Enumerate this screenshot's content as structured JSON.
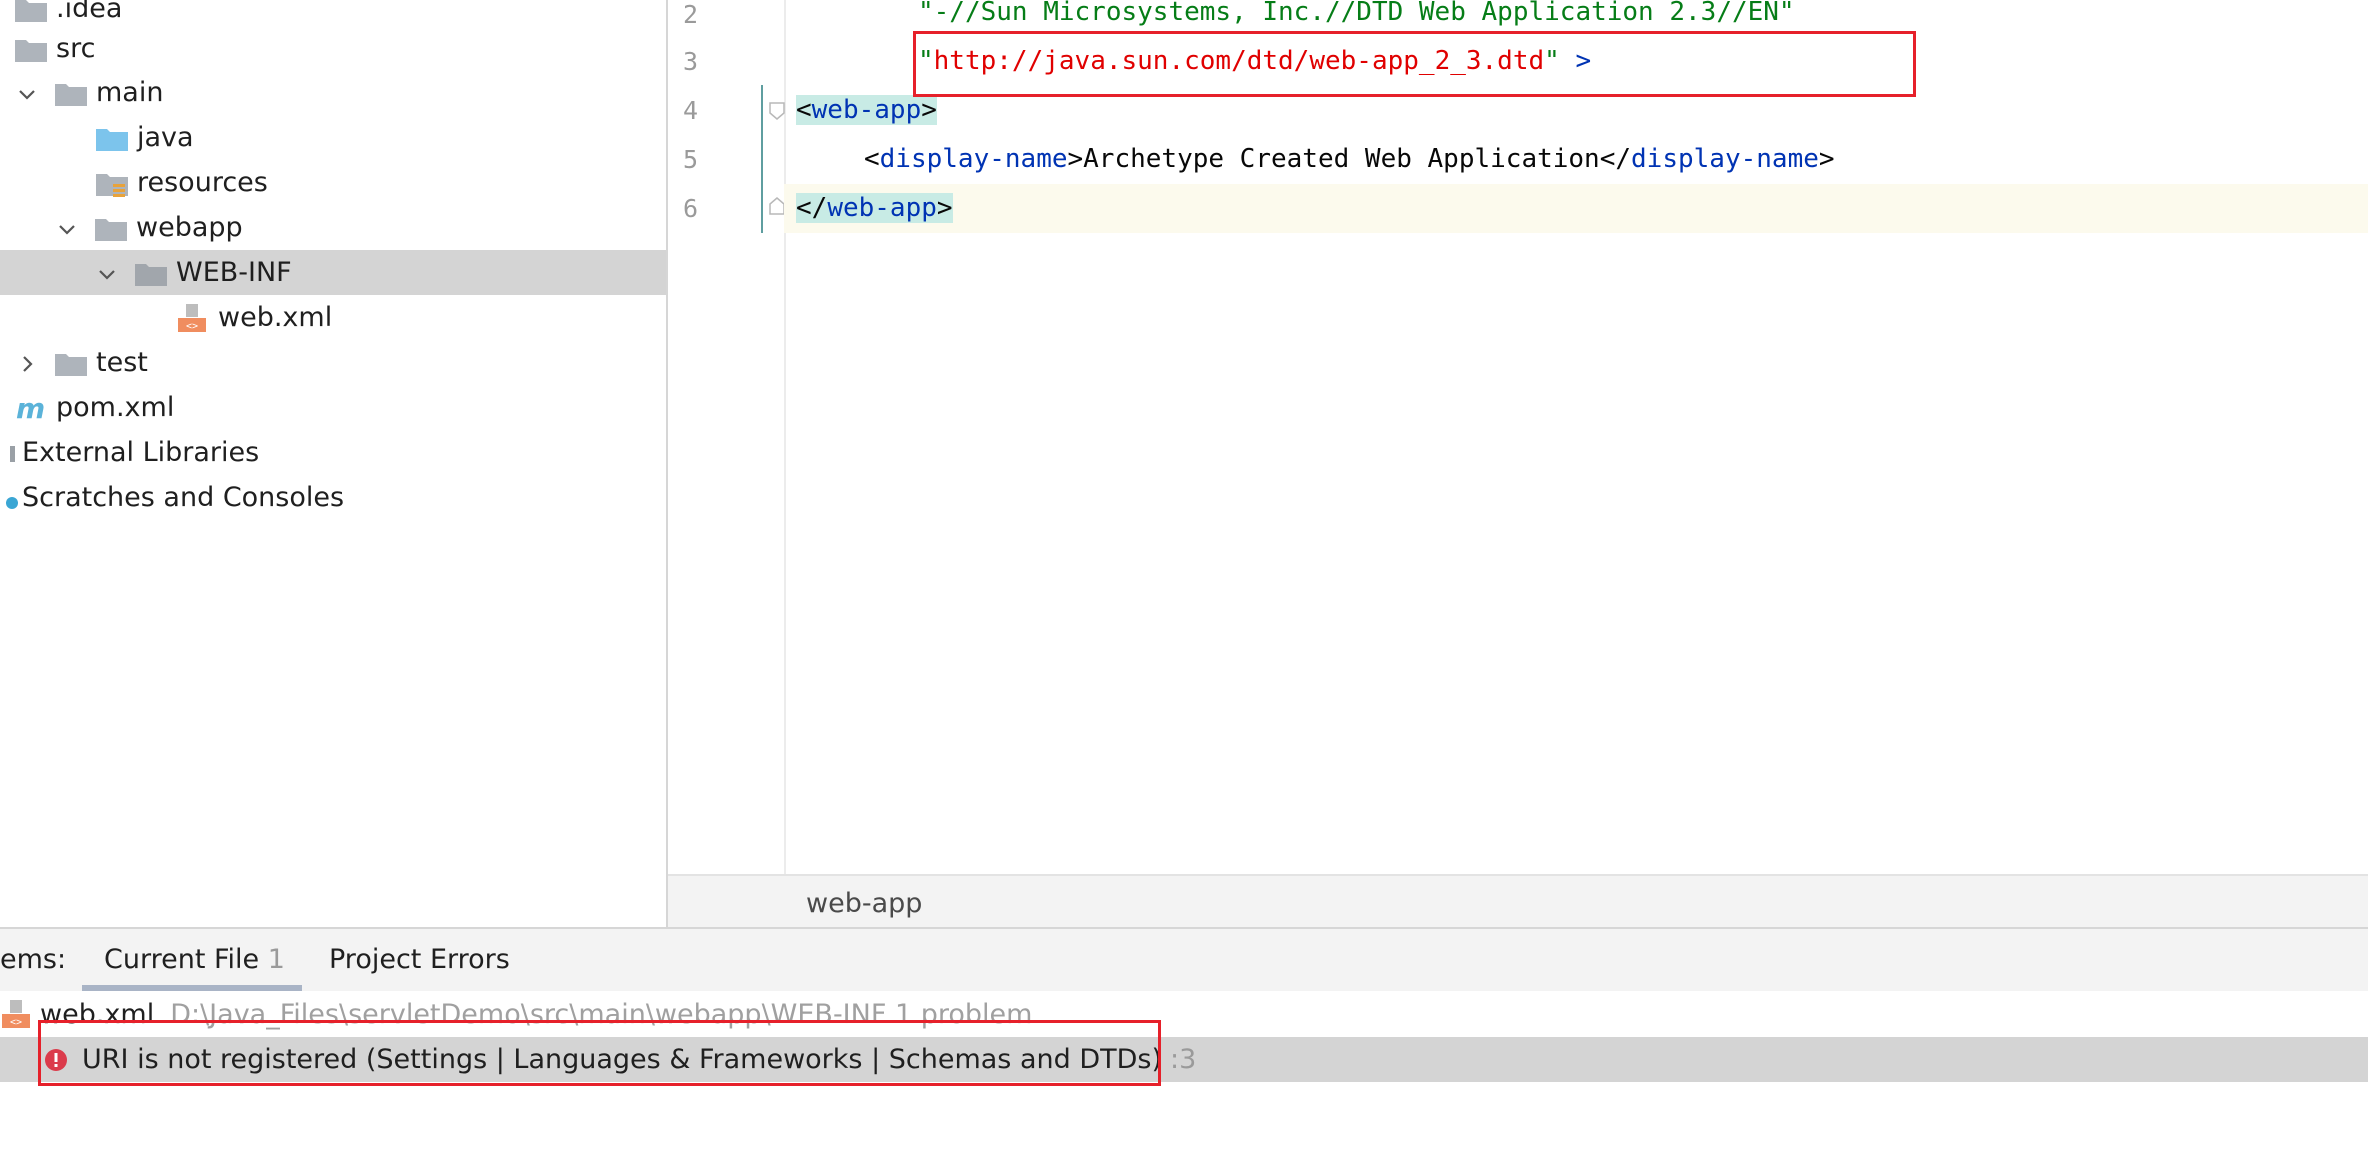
{
  "project_tree": {
    "items": [
      {
        "label": ".idea"
      },
      {
        "label": "src"
      },
      {
        "label": "main"
      },
      {
        "label": "java"
      },
      {
        "label": "resources"
      },
      {
        "label": "webapp"
      },
      {
        "label": "WEB-INF"
      },
      {
        "label": "web.xml"
      },
      {
        "label": "test"
      },
      {
        "label": "pom.xml"
      },
      {
        "label": "External Libraries"
      },
      {
        "label": "Scratches and Consoles"
      }
    ]
  },
  "editor": {
    "line_numbers": [
      "2",
      "3",
      "4",
      "5",
      "6"
    ],
    "lines": {
      "l2_doctype": "\"-//Sun Microsystems, Inc.//DTD Web Application 2.3//EN\"",
      "l3_quote_open": "\"",
      "l3_url": "http://java.sun.com/dtd/web-app_2_3.dtd",
      "l3_quote_close": "\"",
      "l3_close": " >",
      "l4_open": "<",
      "l4_tag": "web-app",
      "l4_close": ">",
      "l5_open": "<",
      "l5_tag": "display-name",
      "l5_mid": ">Archetype Created Web Application</",
      "l5_tag2": "display-name",
      "l5_close": ">",
      "l6_open": "</",
      "l6_tag": "web-app",
      "l6_close": ">"
    },
    "breadcrumb": "web-app"
  },
  "problems": {
    "title": "ems:",
    "tabs": [
      {
        "label": "Current File",
        "count": "1"
      },
      {
        "label": "Project Errors"
      }
    ],
    "file": {
      "name": "web.xml",
      "path": "D:\\Java_Files\\servletDemo\\src\\main\\webapp\\WEB-INF  1 problem"
    },
    "issue": {
      "message": "URI is not registered (Settings | Languages & Frameworks | Schemas and DTDs)",
      "line": ":3"
    }
  },
  "colors": {
    "selection": "#d4d4d4",
    "string": "#067d17",
    "tag": "#0033b3",
    "error_url": "#e00000",
    "annotation_box": "#e6202a",
    "error_icon": "#db3b4b"
  }
}
